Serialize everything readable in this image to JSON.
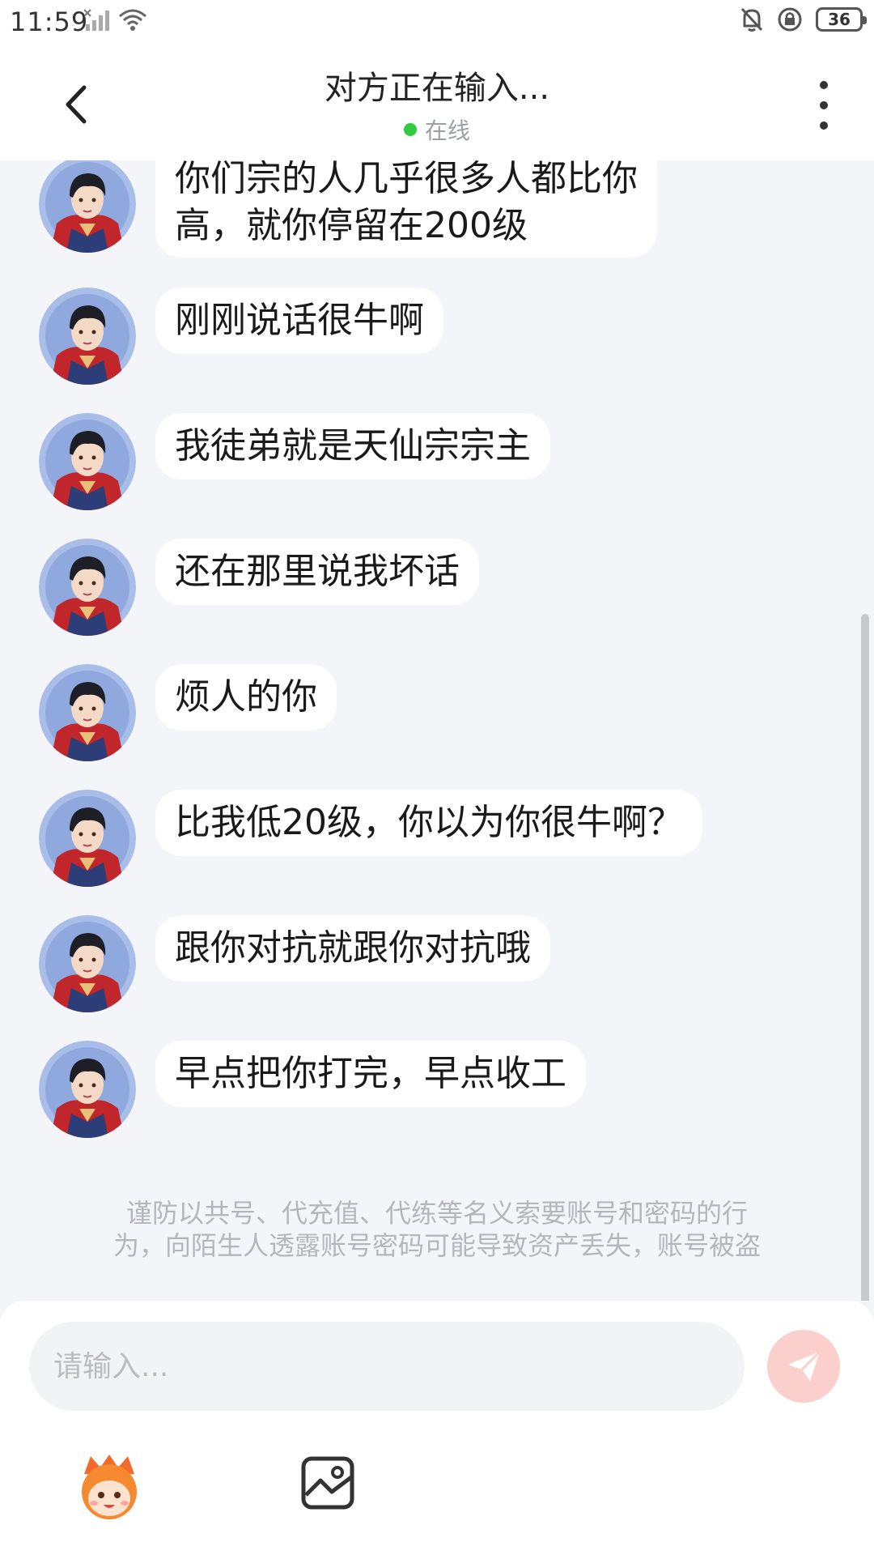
{
  "status_bar": {
    "time": "11:59",
    "battery": "36",
    "icons": [
      "no-sim-signal-icon",
      "wifi-icon",
      "bell-off-icon",
      "rotation-lock-icon",
      "battery-icon"
    ]
  },
  "header": {
    "title": "对方正在输入...",
    "status": "在线",
    "status_color": "#2ecc40",
    "back_icon": "chevron-left-icon",
    "menu_icon": "more-vertical-icon"
  },
  "messages": [
    {
      "lines": [
        "你们宗的人几乎很多人都比你",
        "高，就你停留在200级"
      ]
    },
    {
      "lines": [
        "刚刚说话很牛啊"
      ]
    },
    {
      "lines": [
        "我徒弟就是天仙宗宗主"
      ]
    },
    {
      "lines": [
        "还在那里说我坏话"
      ]
    },
    {
      "lines": [
        "烦人的你"
      ]
    },
    {
      "lines": [
        "比我低20级，你以为你很牛啊？"
      ]
    },
    {
      "lines": [
        "跟你对抗就跟你对抗哦"
      ]
    },
    {
      "lines": [
        "早点把你打完，早点收工"
      ]
    }
  ],
  "warning": {
    "line1": "谨防以共号、代充值、代练等名义索要账号和密码的行",
    "line2": "为，向陌生人透露账号密码可能导致资产丢失，账号被盗"
  },
  "input": {
    "placeholder": "请输入...",
    "value": ""
  },
  "toolbar": {
    "send_icon": "send-icon",
    "emoji_icon": "emoji-mascot-icon",
    "image_icon": "image-icon"
  },
  "colors": {
    "background": "#f4f5f8",
    "bubble": "#ffffff",
    "send_button": "#fbd0cc",
    "accent": "#f36a5a"
  }
}
